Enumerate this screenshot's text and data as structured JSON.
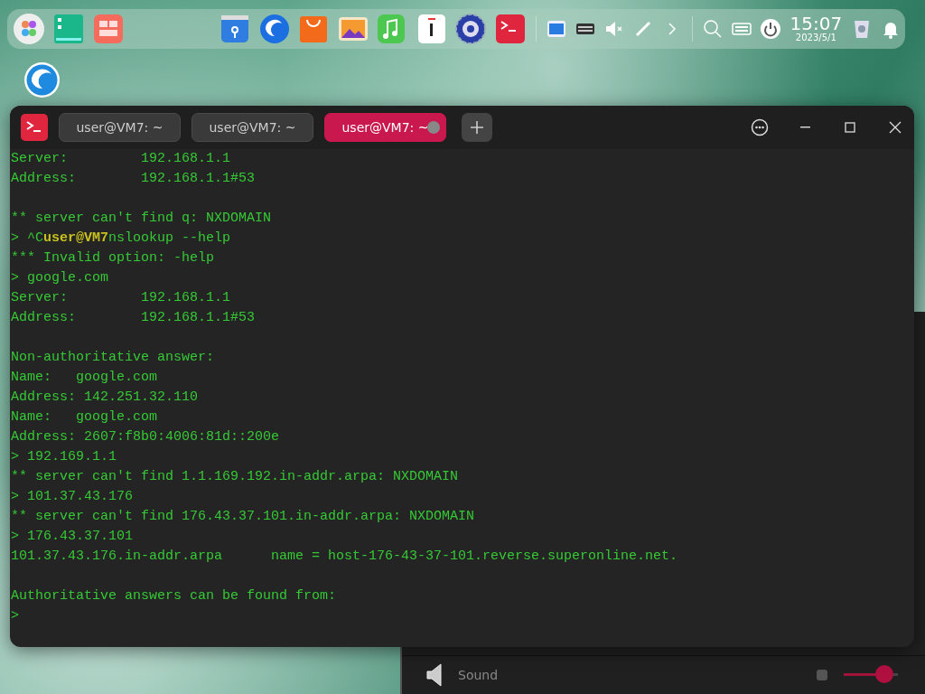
{
  "dock": {
    "clock": {
      "time": "15:07",
      "date": "2023/5/1"
    }
  },
  "background_window": {
    "rows": [
      {
        "label": "Sound",
        "level": 0.75
      }
    ]
  },
  "terminal": {
    "tabs": [
      {
        "label": "user@VM7: ~",
        "selected": false
      },
      {
        "label": "user@VM7: ~",
        "selected": false
      },
      {
        "label": "user@VM7: ~",
        "selected": true
      }
    ],
    "blocks": [
      [
        "Server:         192.168.1.1",
        "Address:        192.168.1.1#53"
      ],
      [
        "** server can't find q: NXDOMAIN",
        "> ^C**user@VM7**nslookup --help",
        "*** Invalid option: -help",
        "> google.com",
        "Server:         192.168.1.1",
        "Address:        192.168.1.1#53"
      ],
      [
        "Non-authoritative answer:",
        "Name:   google.com",
        "Address: 142.251.32.110",
        "Name:   google.com",
        "Address: 2607:f8b0:4006:81d::200e",
        "> 192.169.1.1",
        "** server can't find 1.1.169.192.in-addr.arpa: NXDOMAIN",
        "> 101.37.43.176",
        "** server can't find 176.43.37.101.in-addr.arpa: NXDOMAIN",
        "> 176.43.37.101",
        "101.37.43.176.in-addr.arpa      name = host-176-43-37-101.reverse.superonline.net."
      ],
      [
        "Authoritative answers can be found from:",
        ">"
      ]
    ]
  }
}
